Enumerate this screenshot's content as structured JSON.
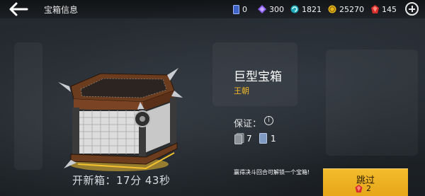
{
  "header": {
    "title": "宝箱信息",
    "currencies": [
      {
        "icon": "blue-card-icon",
        "value": "0"
      },
      {
        "icon": "purple-gem-icon",
        "value": "300"
      },
      {
        "icon": "teal-swirl-icon",
        "value": "1821"
      },
      {
        "icon": "gold-coin-icon",
        "value": "25270"
      },
      {
        "icon": "red-gem-icon",
        "value": "145"
      }
    ]
  },
  "chest": {
    "name": "巨型宝箱",
    "tier": "王朝",
    "timer_label": "开新箱：",
    "timer_value": "17分 43秒"
  },
  "guarantee": {
    "label": "保证：",
    "cards": [
      {
        "icon": "gray-card-icon",
        "count": "7"
      },
      {
        "icon": "blue-card-icon",
        "count": "1"
      }
    ]
  },
  "notice": "赢得决斗回合可解锁一个宝箱!",
  "skip": {
    "label": "跳过",
    "cost": "2",
    "cost_icon": "red-gem-icon"
  },
  "colors": {
    "accent": "#f0b429",
    "button": "#f0b22a",
    "gem": "#d92e2e"
  }
}
